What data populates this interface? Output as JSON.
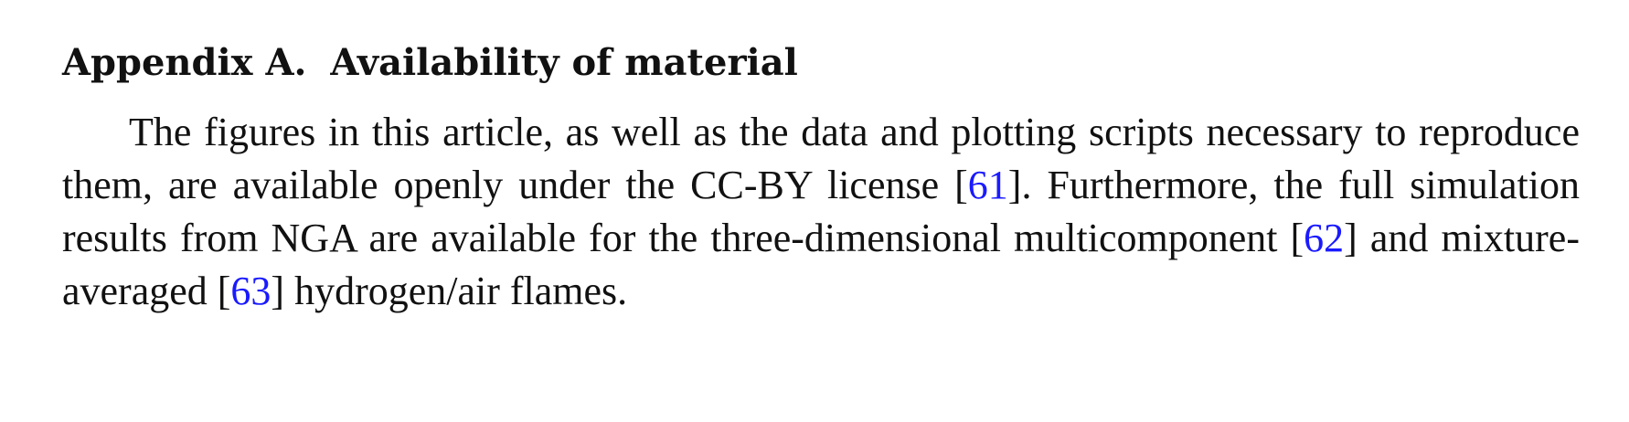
{
  "section": {
    "number": "Appendix A.",
    "title": "Availability of material"
  },
  "paragraph": {
    "part1": "The figures in this article, as well as the data and plotting scripts neces­sary to reproduce them, are available openly under the CC-BY license [",
    "cite1": "61",
    "part2": "]. Furthermore, the full simulation results from NGA are available for the three-dimensional multicomponent [",
    "cite2": "62",
    "part3": "] and mixture-averaged [",
    "cite3": "63",
    "part4": "] hydrogen/air flames."
  },
  "colors": {
    "text": "#111111",
    "citation_link": "#1a1aff"
  }
}
